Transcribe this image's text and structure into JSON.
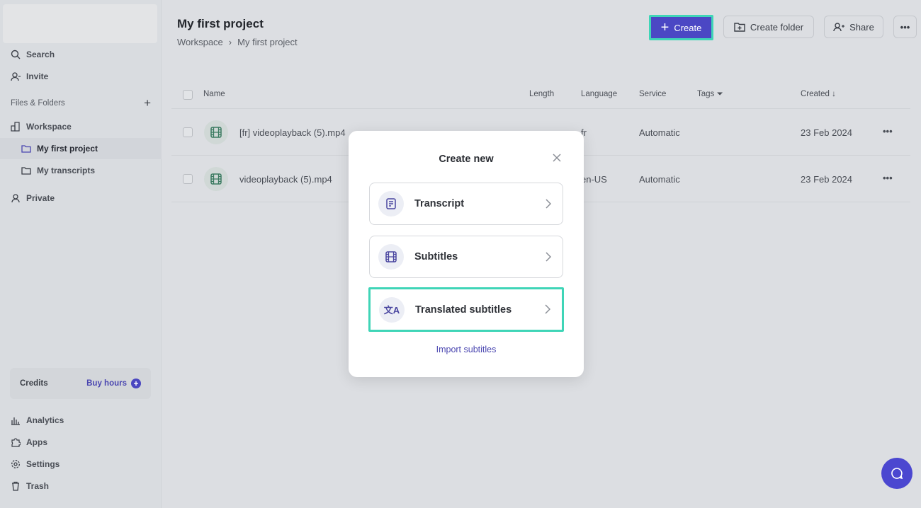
{
  "sidebar": {
    "search": "Search",
    "invite": "Invite",
    "section": "Files & Folders",
    "workspace": "Workspace",
    "project": "My first project",
    "transcripts": "My transcripts",
    "private": "Private",
    "credits": "Credits",
    "buy_hours": "Buy hours",
    "analytics": "Analytics",
    "apps": "Apps",
    "settings": "Settings",
    "trash": "Trash"
  },
  "header": {
    "title": "My first project",
    "breadcrumb": [
      "Workspace",
      "My first project"
    ],
    "create": "Create",
    "create_folder": "Create folder",
    "share": "Share"
  },
  "table": {
    "columns": [
      "Name",
      "Length",
      "Language",
      "Service",
      "Tags",
      "Created"
    ],
    "rows": [
      {
        "name": "[fr] videoplayback (5).mp4",
        "length": "",
        "language": "fr",
        "service": "Automatic",
        "created": "23 Feb 2024"
      },
      {
        "name": "videoplayback (5).mp4",
        "length": "",
        "language": "en-US",
        "service": "Automatic",
        "created": "23 Feb 2024"
      }
    ]
  },
  "modal": {
    "title": "Create new",
    "options": [
      "Transcript",
      "Subtitles",
      "Translated subtitles"
    ],
    "import": "Import subtitles"
  },
  "colors": {
    "accent": "#4b47c4",
    "highlight": "#3fd5b7"
  }
}
